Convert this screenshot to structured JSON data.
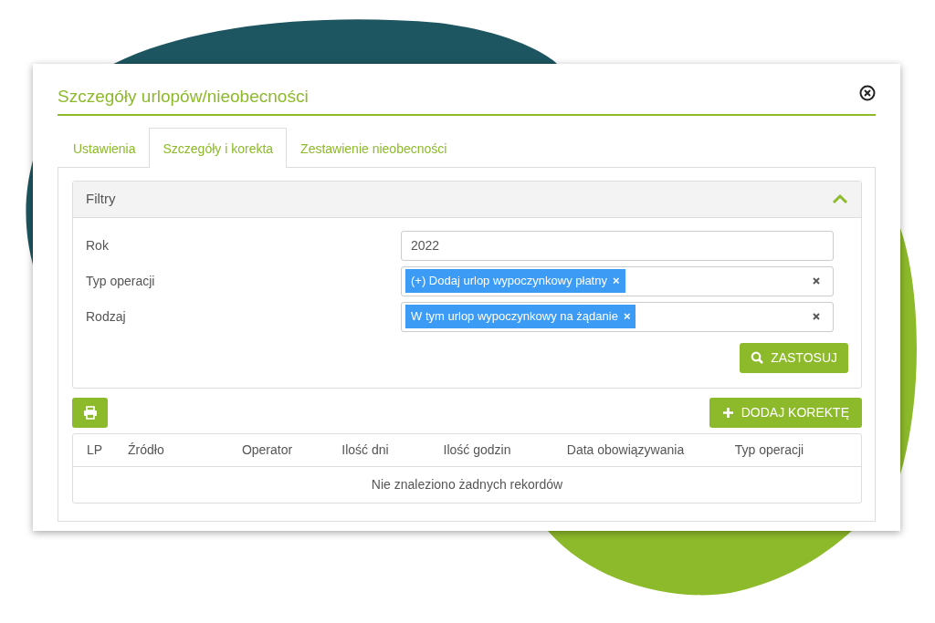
{
  "dialog": {
    "title": "Szczegóły urlopów/nieobecności"
  },
  "tabs": [
    {
      "label": "Ustawienia",
      "selected": false
    },
    {
      "label": "Szczegóły i korekta",
      "selected": true
    },
    {
      "label": "Zestawienie nieobecności",
      "selected": false
    }
  ],
  "filters": {
    "title": "Filtry",
    "expanded": true,
    "fields": [
      {
        "label": "Rok",
        "kind": "text",
        "value": "2022"
      },
      {
        "label": "Typ operacji",
        "kind": "multiselect",
        "chips": [
          {
            "text": "(+) Dodaj urlop wypoczynkowy płatny",
            "remove": "×"
          }
        ]
      },
      {
        "label": "Rodzaj",
        "kind": "multiselect",
        "chips": [
          {
            "text": "W tym urlop wypoczynkowy na żądanie",
            "remove": "×"
          }
        ]
      }
    ],
    "apply_button": "ZASTOSUJ"
  },
  "add_button": "DODAJ KOREKTĘ",
  "table": {
    "columns": [
      "LP",
      "Źródło",
      "Operator",
      "Ilość dni",
      "Ilość godzin",
      "Data obowiązywania",
      "Typ operacji"
    ],
    "empty_message": "Nie znaleziono żadnych rekordów"
  }
}
